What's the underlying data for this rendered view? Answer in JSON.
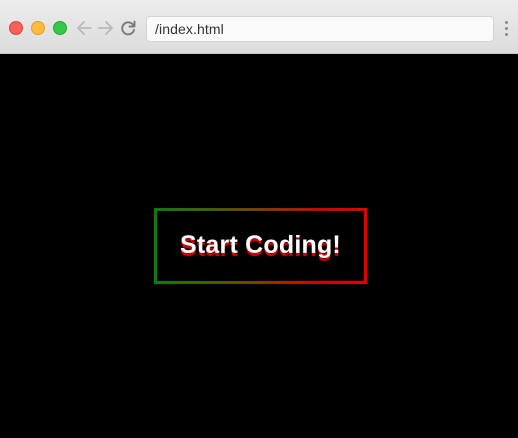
{
  "browser": {
    "address": "/index.html",
    "icons": {
      "back": "arrow-left-icon",
      "forward": "arrow-right-icon",
      "reload": "reload-icon",
      "menu": "more-vertical-icon"
    },
    "traffic_lights": {
      "close": "#fc605c",
      "minimize": "#fcbb40",
      "zoom": "#34c84a"
    }
  },
  "page": {
    "background": "#000000",
    "cta": {
      "label": "Start Coding!",
      "border_gradient": [
        "#0e7a14",
        "#e00000"
      ],
      "text_color": "#ffffff",
      "text_shadow_color": "#d00000"
    }
  }
}
